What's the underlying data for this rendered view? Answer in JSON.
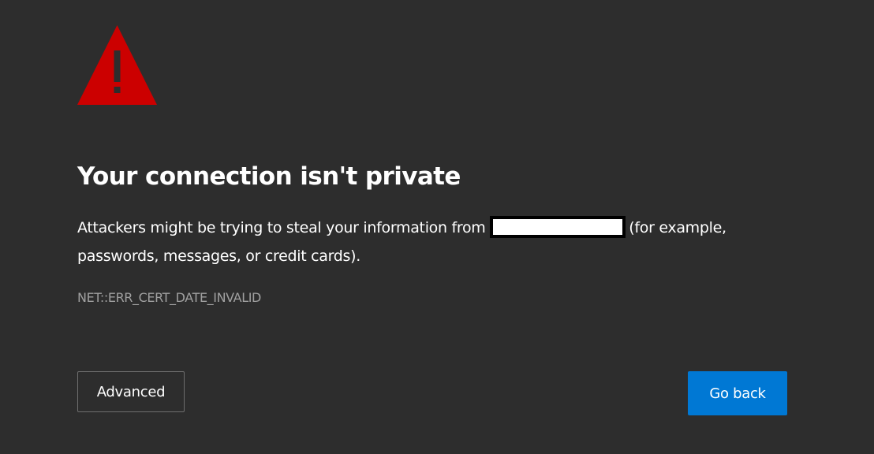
{
  "page": {
    "title": "Your connection isn't private",
    "message_before": "Attackers might be trying to steal your information from",
    "message_after": "(for example, passwords, messages, or credit cards).",
    "error_code": "NET::ERR_CERT_DATE_INVALID"
  },
  "buttons": {
    "advanced_label": "Advanced",
    "go_back_label": "Go back"
  },
  "icons": {
    "warning": "warning-triangle-icon"
  },
  "colors": {
    "background": "#2d2d2d",
    "warning_red": "#cc0000",
    "primary_button": "#0078d4",
    "error_code_text": "#a0a0a0"
  }
}
